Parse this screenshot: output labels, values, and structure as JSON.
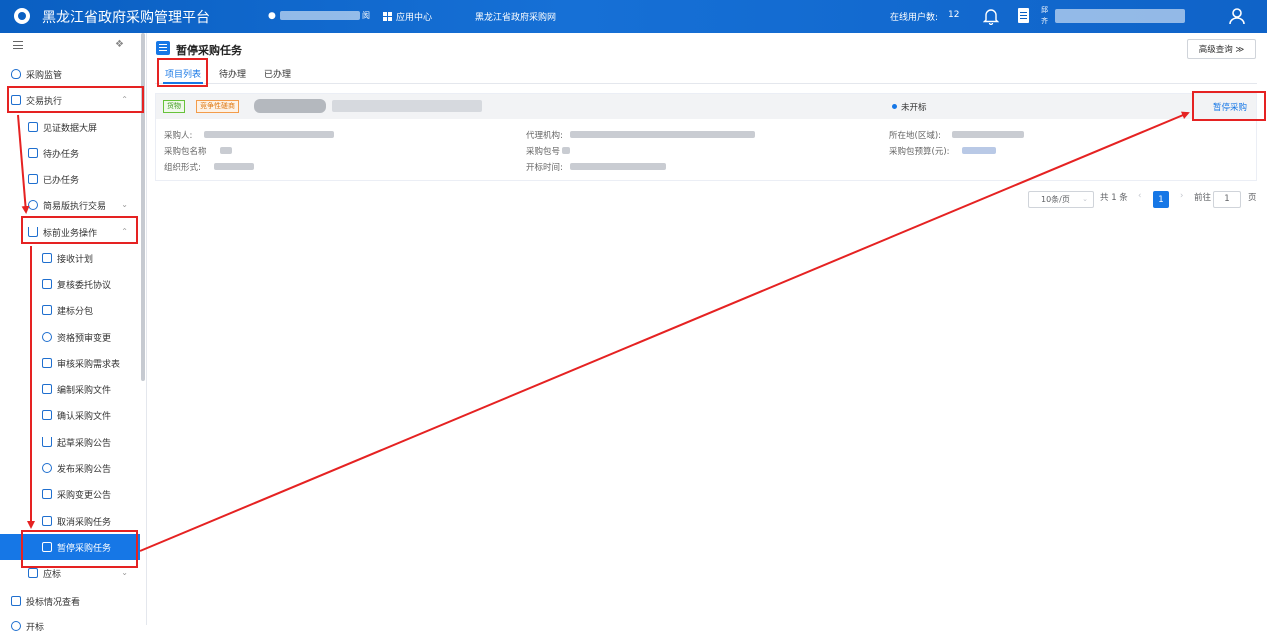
{
  "topbar": {
    "title": "黑龙江省政府采购管理平台",
    "location_suffix": "阂",
    "apps_label": "应用中心",
    "site_link": "黑龙江省政府采购网",
    "online_label": "在线用户数:",
    "online_count": "12",
    "user_line1": "邱",
    "user_line2": "齐"
  },
  "sidebar": {
    "items": [
      {
        "label": "采购监管"
      },
      {
        "label": "交易执行"
      },
      {
        "label": "见证数据大屏"
      },
      {
        "label": "待办任务"
      },
      {
        "label": "已办任务"
      },
      {
        "label": "简易版执行交易"
      },
      {
        "label": "标前业务操作"
      },
      {
        "label": "接收计划"
      },
      {
        "label": "复核委托协议"
      },
      {
        "label": "建标分包"
      },
      {
        "label": "资格预审变更"
      },
      {
        "label": "审核采购需求表"
      },
      {
        "label": "编制采购文件"
      },
      {
        "label": "确认采购文件"
      },
      {
        "label": "起草采购公告"
      },
      {
        "label": "发布采购公告"
      },
      {
        "label": "采购变更公告"
      },
      {
        "label": "取消采购任务"
      },
      {
        "label": "暂停采购任务"
      },
      {
        "label": "应标"
      },
      {
        "label": "投标情况查看"
      },
      {
        "label": "开标"
      }
    ]
  },
  "main": {
    "title": "暂停采购任务",
    "advanced_query": "高级查询 ≫",
    "tabs": [
      "项目列表",
      "待办理",
      "已办理"
    ],
    "card": {
      "tag_goods": "货物",
      "tag_method": "竞争性磋商",
      "status": "未开标",
      "action": "暂停采购",
      "fields": {
        "purchaser": "采购人:",
        "agency": "代理机构:",
        "region": "所在地(区域):",
        "package_name": "采购包名称",
        "package_no": "采购包号",
        "budget": "采购包预算(元):",
        "org_form": "组织形式:",
        "open_time": "开标时间:"
      }
    },
    "pager": {
      "page_size": "10条/页",
      "total": "共 1 条",
      "current": "1",
      "goto_label": "前往",
      "goto_value": "1",
      "page_unit": "页"
    }
  },
  "colors": {
    "topbar": "#0a5fc2",
    "accent": "#1677e6",
    "annotation": "#e52222"
  }
}
